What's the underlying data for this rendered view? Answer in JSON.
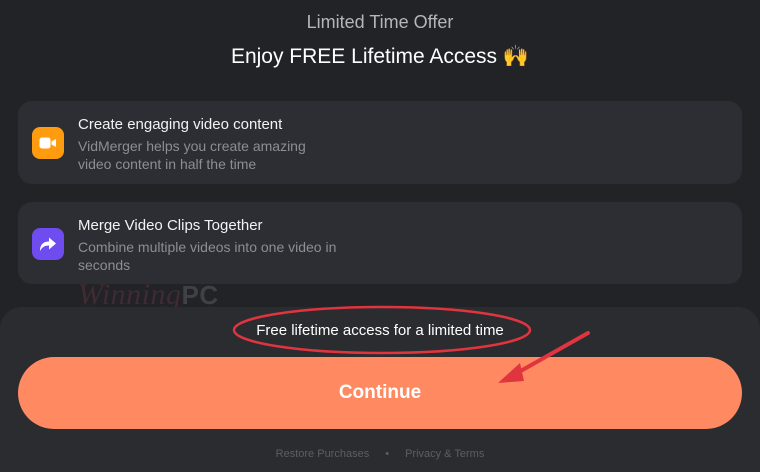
{
  "header": {
    "subtitle": "Limited Time Offer",
    "title": "Enjoy FREE Lifetime Access",
    "emoji": "🙌"
  },
  "features": [
    {
      "icon": "video-camera-icon",
      "icon_color": "#ff9b0f",
      "title": "Create engaging video content",
      "description": "VidMerger helps you create amazing video content in half the time"
    },
    {
      "icon": "share-arrow-icon",
      "icon_color": "#6f4cf0",
      "title": "Merge Video Clips Together",
      "description": "Combine multiple videos into one video in seconds"
    }
  ],
  "watermark": {
    "text_main": "Winning",
    "text_pc": "PC"
  },
  "offer": {
    "text": "Free lifetime access for a limited time"
  },
  "cta": {
    "label": "Continue",
    "color": "#ff8a61"
  },
  "footer": {
    "restore": "Restore Purchases",
    "separator": "•",
    "privacy": "Privacy & Terms"
  },
  "colors": {
    "background": "#222327",
    "card": "#2d2e33",
    "annotation_red": "#e0343f"
  }
}
